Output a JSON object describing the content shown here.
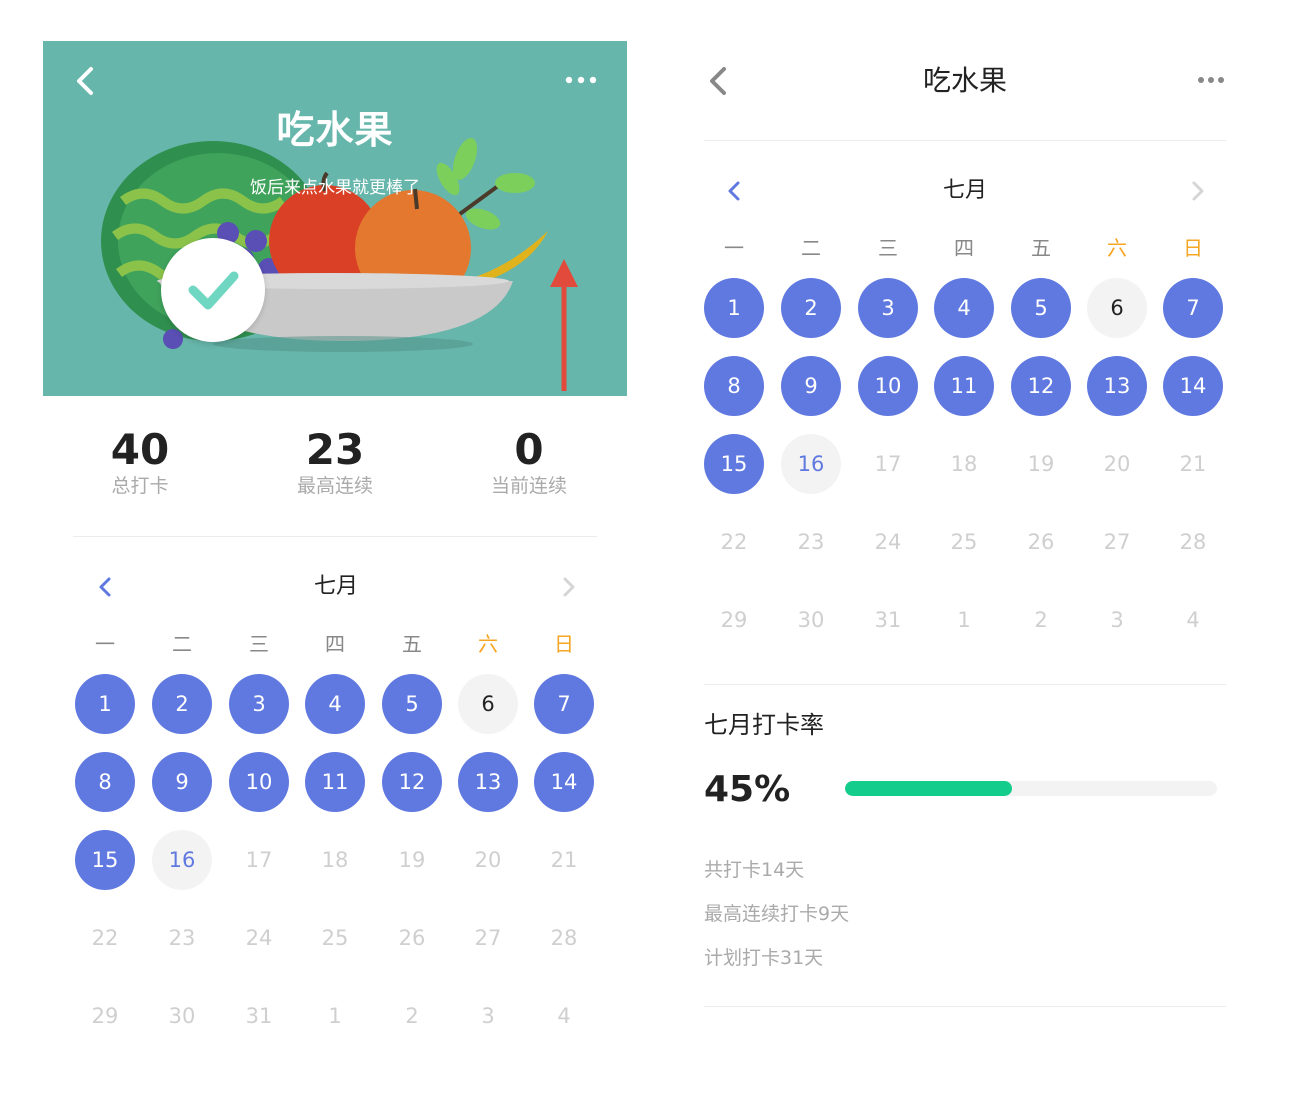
{
  "colors": {
    "hero_bg": "#67b6ab",
    "accent": "#6079e0",
    "weekend": "#f5a623",
    "progress": "#14cc8c",
    "muted": "#aaaaaa"
  },
  "icons": [
    "chevron-left-icon",
    "more-dots-icon",
    "checkmark-icon",
    "arrow-up-icon",
    "fruit-bowl-illustration"
  ],
  "left": {
    "hero": {
      "title": "吃水果",
      "subtitle": "饭后来点水果就更棒了"
    },
    "stats": [
      {
        "value": "40",
        "label": "总打卡"
      },
      {
        "value": "23",
        "label": "最高连续"
      },
      {
        "value": "0",
        "label": "当前连续"
      }
    ]
  },
  "right": {
    "header": {
      "title": "吃水果"
    },
    "rate": {
      "title": "七月打卡率",
      "value": "45%",
      "fraction": 0.45,
      "lines": [
        "共打卡14天",
        "最高连续打卡9天",
        "计划打卡31天"
      ]
    }
  },
  "calendar": {
    "month": "七月",
    "weekdays": [
      "一",
      "二",
      "三",
      "四",
      "五",
      "六",
      "日"
    ],
    "weekend_index": [
      5,
      6
    ],
    "weeks": [
      [
        {
          "d": "1",
          "s": "done"
        },
        {
          "d": "2",
          "s": "done"
        },
        {
          "d": "3",
          "s": "done"
        },
        {
          "d": "4",
          "s": "done"
        },
        {
          "d": "5",
          "s": "done"
        },
        {
          "d": "6",
          "s": "missed"
        },
        {
          "d": "7",
          "s": "done"
        }
      ],
      [
        {
          "d": "8",
          "s": "done"
        },
        {
          "d": "9",
          "s": "done"
        },
        {
          "d": "10",
          "s": "done"
        },
        {
          "d": "11",
          "s": "done"
        },
        {
          "d": "12",
          "s": "done"
        },
        {
          "d": "13",
          "s": "done"
        },
        {
          "d": "14",
          "s": "done"
        }
      ],
      [
        {
          "d": "15",
          "s": "done"
        },
        {
          "d": "16",
          "s": "today"
        },
        {
          "d": "17",
          "s": "future"
        },
        {
          "d": "18",
          "s": "future"
        },
        {
          "d": "19",
          "s": "future"
        },
        {
          "d": "20",
          "s": "future"
        },
        {
          "d": "21",
          "s": "future"
        }
      ],
      [
        {
          "d": "22",
          "s": "future"
        },
        {
          "d": "23",
          "s": "future"
        },
        {
          "d": "24",
          "s": "future"
        },
        {
          "d": "25",
          "s": "future"
        },
        {
          "d": "26",
          "s": "future"
        },
        {
          "d": "27",
          "s": "future"
        },
        {
          "d": "28",
          "s": "future"
        }
      ],
      [
        {
          "d": "29",
          "s": "future"
        },
        {
          "d": "30",
          "s": "future"
        },
        {
          "d": "31",
          "s": "future"
        },
        {
          "d": "1",
          "s": "other"
        },
        {
          "d": "2",
          "s": "other"
        },
        {
          "d": "3",
          "s": "other"
        },
        {
          "d": "4",
          "s": "other"
        }
      ]
    ]
  }
}
